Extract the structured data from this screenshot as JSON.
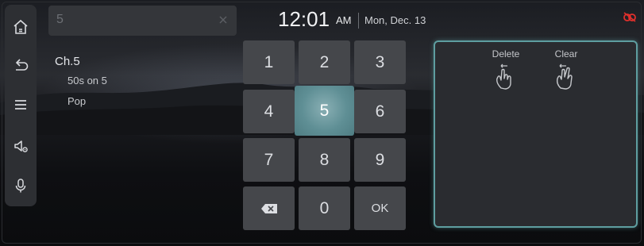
{
  "search": {
    "value": "5",
    "clear_icon": "close-icon"
  },
  "results": {
    "channel": "Ch.5",
    "station_name": "50s on 5",
    "genre": "Pop"
  },
  "clock": {
    "time": "12:01",
    "ampm": "AM",
    "date": "Mon, Dec. 13"
  },
  "sidebar": {
    "items": [
      {
        "icon": "home-icon"
      },
      {
        "icon": "back-icon"
      },
      {
        "icon": "menu-icon"
      },
      {
        "icon": "sound-settings-icon"
      },
      {
        "icon": "microphone-icon"
      }
    ]
  },
  "keypad": {
    "keys": [
      "1",
      "2",
      "3",
      "4",
      "5",
      "6",
      "7",
      "8",
      "9",
      "0"
    ],
    "selected_key": "5",
    "backspace_icon": "backspace-icon",
    "ok_label": "OK"
  },
  "handwriting": {
    "delete_label": "Delete",
    "clear_label": "Clear"
  },
  "status": {
    "icon": "connection-off-icon",
    "accent": "#e0302c"
  },
  "colors": {
    "accent": "#5e9ea0",
    "selected_key": "#6a9aa0",
    "key": "#45474b"
  }
}
